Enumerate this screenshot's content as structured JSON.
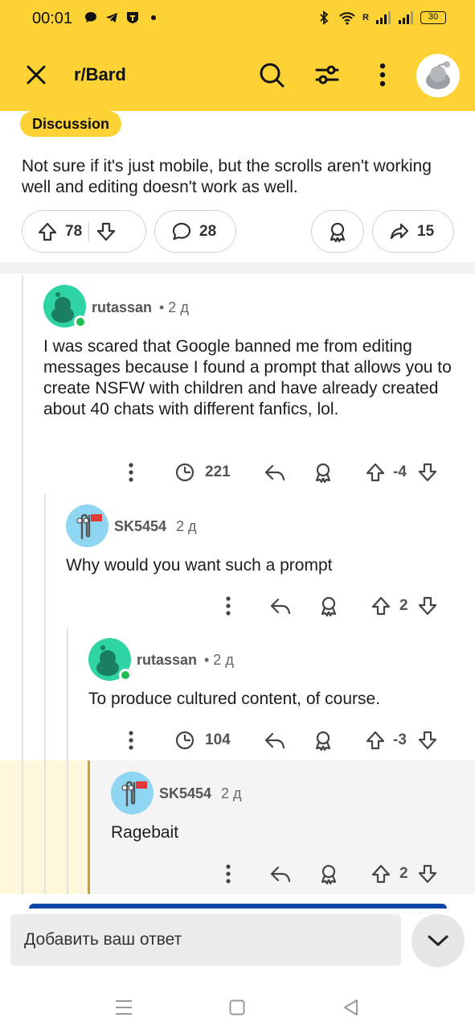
{
  "status_bar": {
    "time": "00:01",
    "network_label": "R",
    "battery": "30"
  },
  "header": {
    "subreddit": "r/Bard"
  },
  "post": {
    "flair": "Discussion",
    "body": "Not sure if it's just mobile, but the scrolls aren't working well and editing doesn't work as well.",
    "upvotes": "78",
    "comments": "28",
    "shares": "15"
  },
  "comments": [
    {
      "author": "rutassan",
      "time": "• 2 д",
      "text": "I was scared that Google banned me from editing messages because I found a prompt that allows you to create NSFW with children and have already created about 40 chats with different fanfics, lol.",
      "views": "221",
      "score": "-4"
    },
    {
      "author": "SK5454",
      "time": "2 д",
      "text": "Why would you want such a prompt",
      "score": "2"
    },
    {
      "author": "rutassan",
      "time": "• 2 д",
      "text": "To produce cultured content, of course.",
      "views": "104",
      "score": "-3"
    },
    {
      "author": "SK5454",
      "time": "2 д",
      "text": "Ragebait",
      "score": "2"
    }
  ],
  "composer": {
    "placeholder": "Добавить ваш ответ"
  },
  "colors": {
    "brand_yellow": "#fcd235",
    "online_green": "#1fbc4f",
    "avatar_teal": "#2ed4a4",
    "avatar_blue": "#8fd6f2"
  },
  "icons": [
    "close-icon",
    "search-icon",
    "filter-icon",
    "more-vertical-icon",
    "upvote-icon",
    "downvote-icon",
    "comment-icon",
    "award-icon",
    "share-icon",
    "views-icon",
    "reply-icon",
    "chevron-down-icon"
  ]
}
